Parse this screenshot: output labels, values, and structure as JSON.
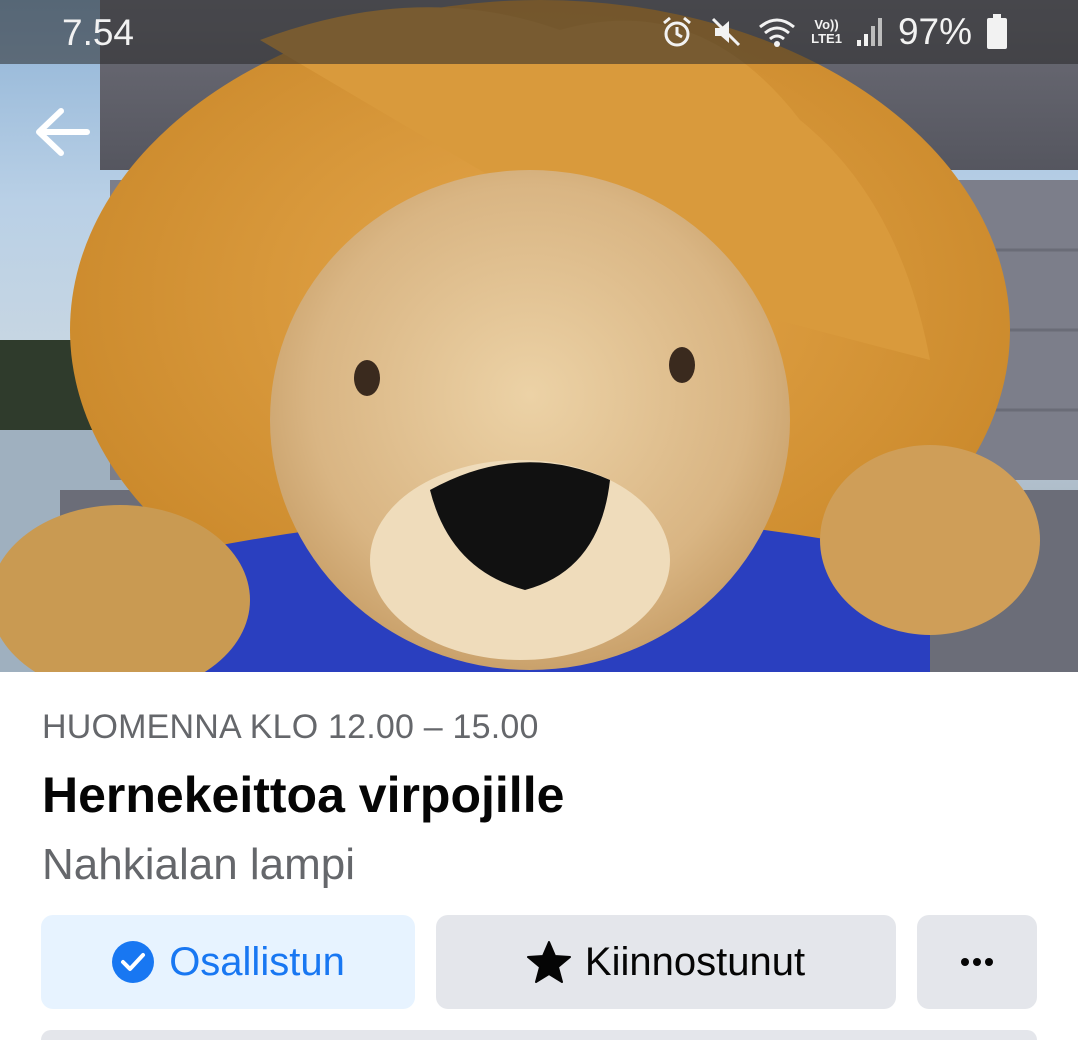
{
  "status_bar": {
    "time": "7.54",
    "network_label_top": "Vo))",
    "network_label_bottom": "LTE1",
    "battery_percent": "97%",
    "icons": [
      "alarm-icon",
      "mute-icon",
      "wifi-icon",
      "volte-icon",
      "signal-icon",
      "battery-icon"
    ]
  },
  "hero": {
    "icon": "back-arrow-icon"
  },
  "event": {
    "date_time": "HUOMENNA KLO 12.00 – 15.00",
    "title": "Hernekeittoa virpojille",
    "location": "Nahkialan lampi"
  },
  "actions": {
    "going_label": "Osallistun",
    "going_icon": "check-circle-icon",
    "interested_label": "Kiinnostunut",
    "interested_icon": "star-icon",
    "more_icon": "more-dots-icon"
  },
  "colors": {
    "accent": "#1877f2",
    "going_bg": "#e7f3ff",
    "secondary_bg": "#e4e6eb",
    "secondary_text": "#65676b"
  }
}
